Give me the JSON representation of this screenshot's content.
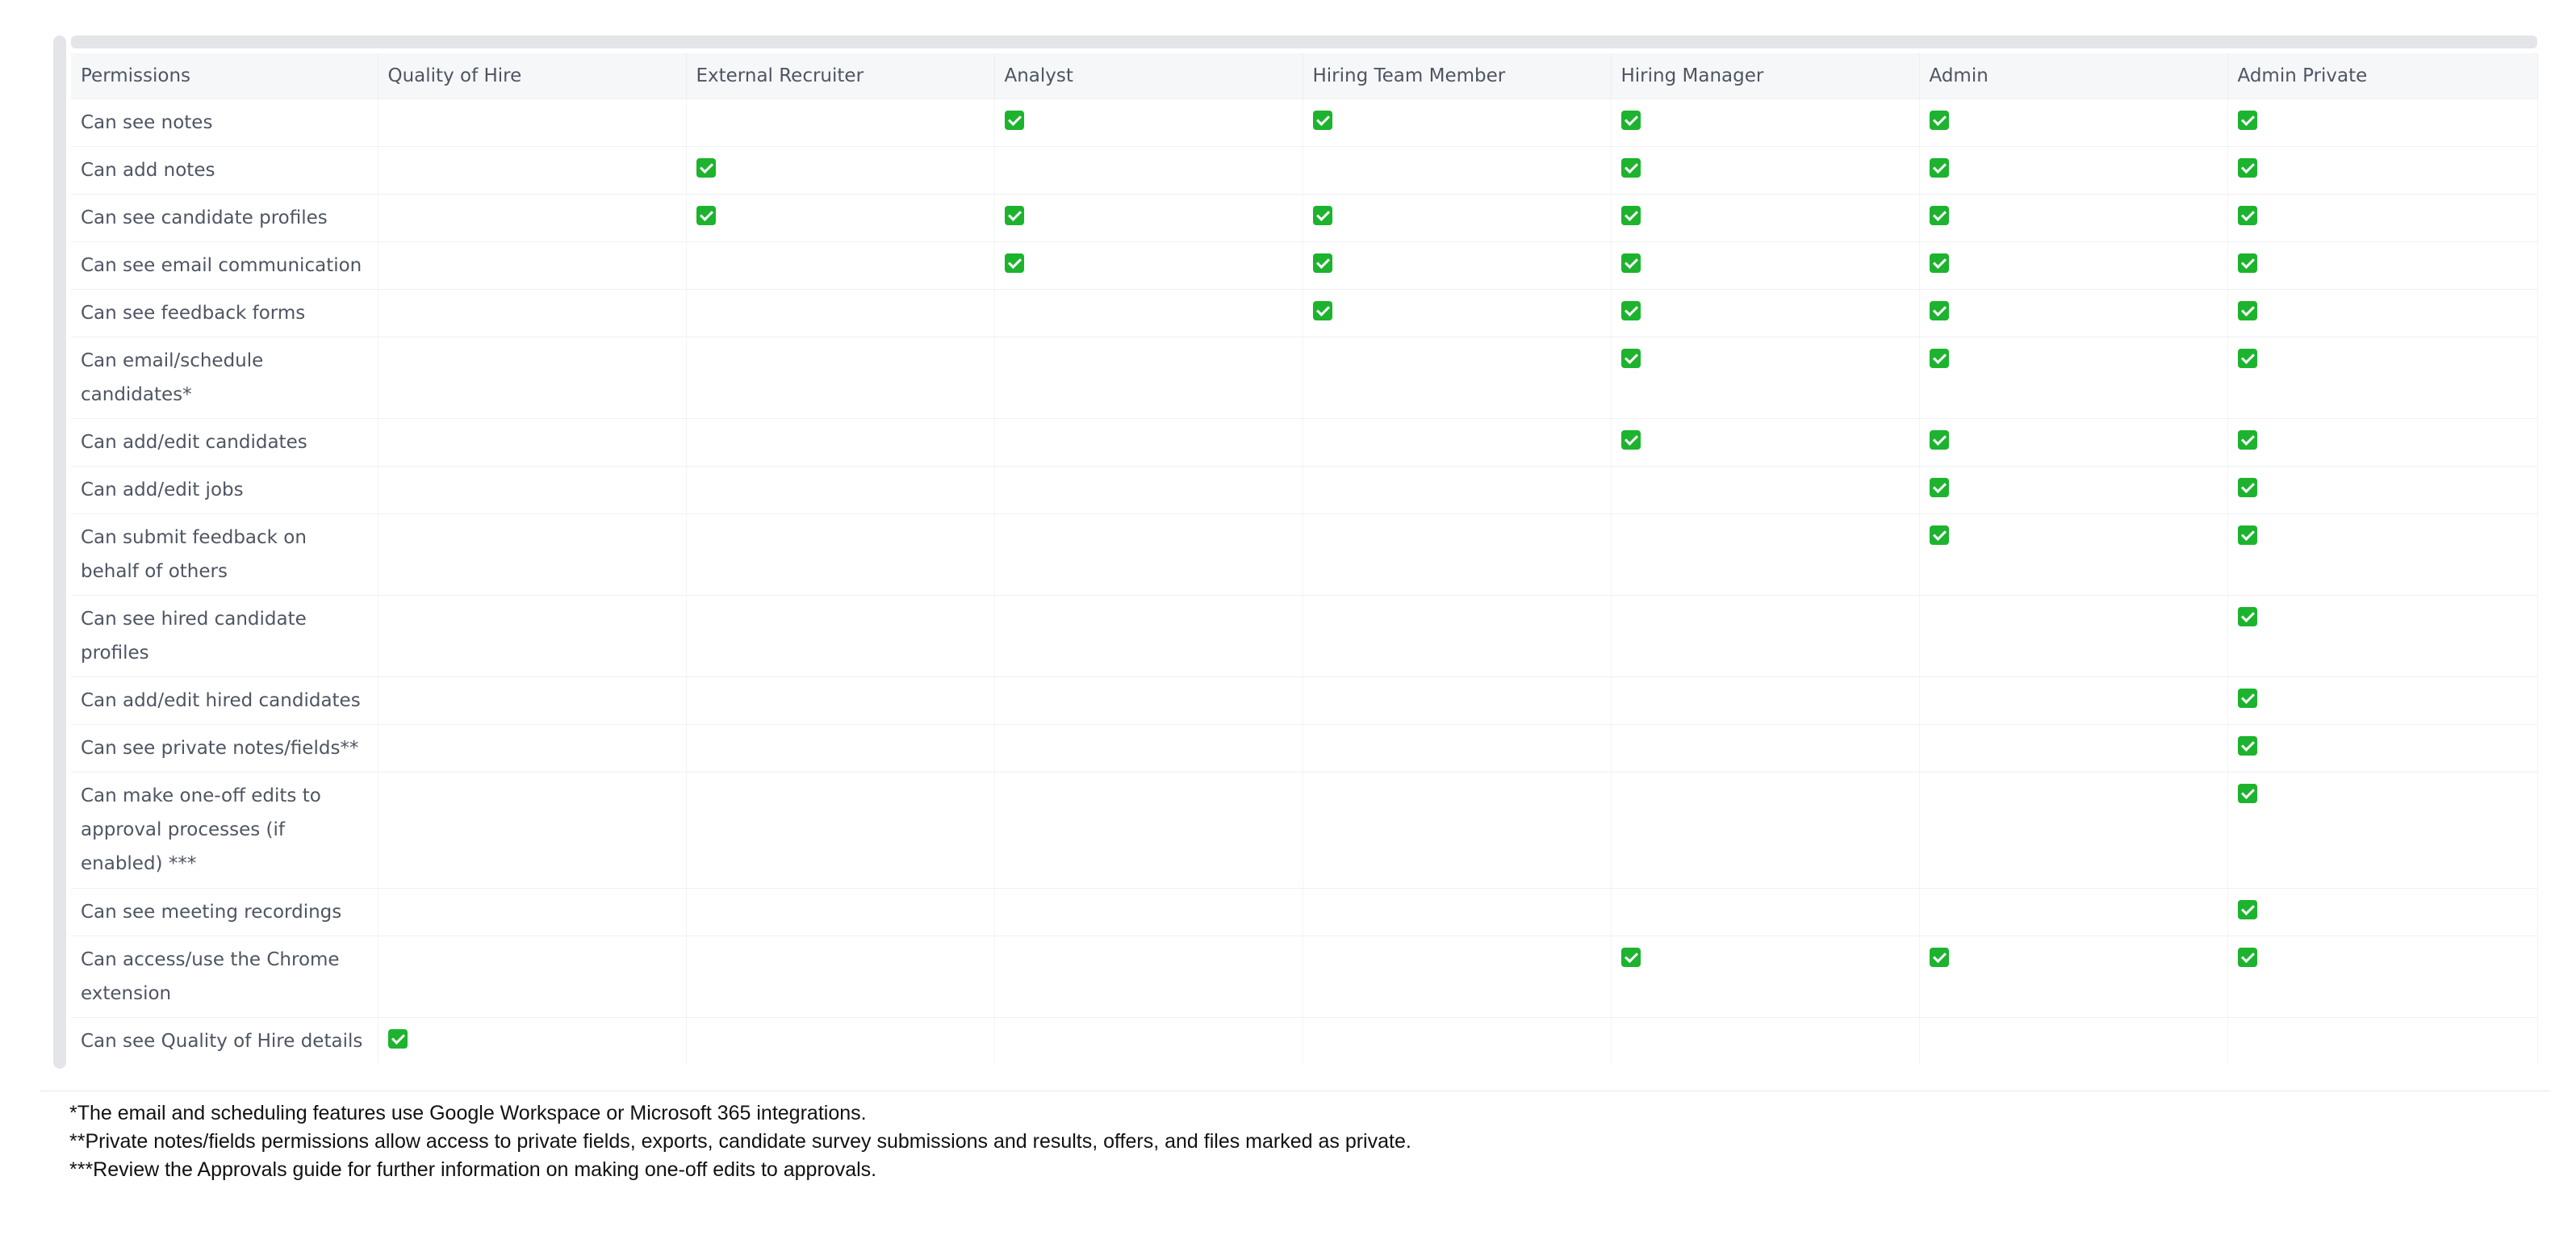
{
  "table": {
    "headers": [
      "Permissions",
      "Quality of Hire",
      "External Recruiter",
      "Analyst",
      "Hiring Team Member",
      "Hiring Manager",
      "Admin",
      "Admin Private"
    ],
    "rows": [
      {
        "label": "Can see notes",
        "checks": [
          false,
          false,
          true,
          true,
          true,
          true,
          true
        ]
      },
      {
        "label": "Can add notes",
        "checks": [
          false,
          true,
          false,
          false,
          true,
          true,
          true
        ]
      },
      {
        "label": "Can see candidate profiles",
        "checks": [
          false,
          true,
          true,
          true,
          true,
          true,
          true
        ]
      },
      {
        "label": "Can see email communication",
        "checks": [
          false,
          false,
          true,
          true,
          true,
          true,
          true
        ]
      },
      {
        "label": "Can see feedback forms",
        "checks": [
          false,
          false,
          false,
          true,
          true,
          true,
          true
        ]
      },
      {
        "label": "Can email/schedule candidates*",
        "checks": [
          false,
          false,
          false,
          false,
          true,
          true,
          true
        ]
      },
      {
        "label": "Can add/edit candidates",
        "checks": [
          false,
          false,
          false,
          false,
          true,
          true,
          true
        ]
      },
      {
        "label": "Can add/edit jobs",
        "checks": [
          false,
          false,
          false,
          false,
          false,
          true,
          true
        ]
      },
      {
        "label": "Can submit feedback on behalf of others",
        "checks": [
          false,
          false,
          false,
          false,
          false,
          true,
          true
        ]
      },
      {
        "label": "Can see hired candidate profiles",
        "checks": [
          false,
          false,
          false,
          false,
          false,
          false,
          true
        ]
      },
      {
        "label": "Can add/edit hired candidates",
        "checks": [
          false,
          false,
          false,
          false,
          false,
          false,
          true
        ]
      },
      {
        "label": "Can see private notes/fields**",
        "checks": [
          false,
          false,
          false,
          false,
          false,
          false,
          true
        ]
      },
      {
        "label": "Can make one-off edits to approval processes (if enabled) ***",
        "checks": [
          false,
          false,
          false,
          false,
          false,
          false,
          true
        ]
      },
      {
        "label": "Can see meeting recordings",
        "checks": [
          false,
          false,
          false,
          false,
          false,
          false,
          true
        ]
      },
      {
        "label": "Can access/use the Chrome extension",
        "checks": [
          false,
          false,
          false,
          false,
          true,
          true,
          true
        ]
      },
      {
        "label": "Can see Quality of Hire details",
        "checks": [
          true,
          false,
          false,
          false,
          false,
          false,
          false
        ]
      }
    ]
  },
  "footnotes": [
    "*The email and scheduling features use Google Workspace or Microsoft 365 integrations.",
    "**Private notes/fields permissions allow access to private fields, exports, candidate survey submissions and results, offers, and files marked as private.",
    "***Review the Approvals guide for further information on making one-off edits to approvals."
  ],
  "colors": {
    "check": "#1db32e",
    "header_bg": "#f6f7f9",
    "scrollbar": "#e3e5e8",
    "text": "#4e5562"
  }
}
